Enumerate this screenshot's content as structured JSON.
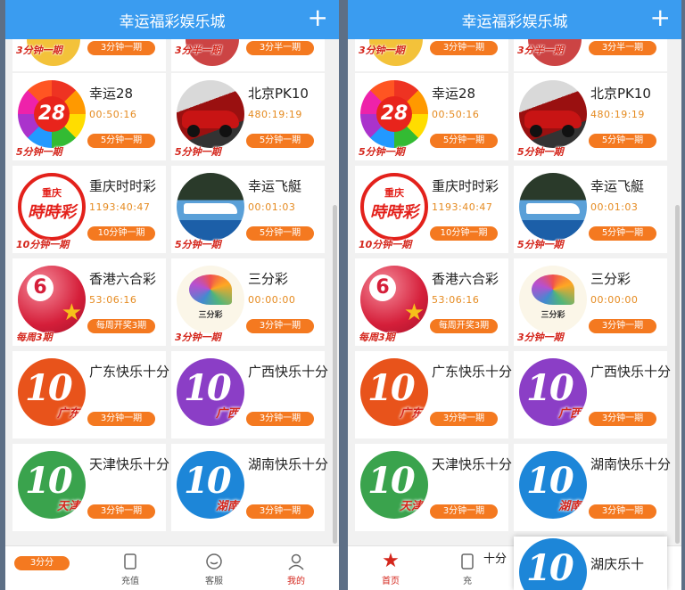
{
  "app_title": "幸运福彩娱乐城",
  "colors": {
    "header": "#3a9cf0",
    "pill": "#f47920",
    "timer": "#e58a1f",
    "badge": "#d4261c"
  },
  "top_partial": {
    "left_pill": "3分钟一期",
    "left_badge": "3分钟一期",
    "right_pill": "3分半一期",
    "right_badge": "3分半一期"
  },
  "games": [
    {
      "name": "幸运28",
      "timer": "00:50:16",
      "pill": "5分钟一期",
      "badge": "5分钟一期",
      "icon": "lucky28-wheel-icon",
      "icon_text": "28"
    },
    {
      "name": "北京PK10",
      "timer": "480:19:19",
      "pill": "5分钟一期",
      "badge": "5分钟一期",
      "icon": "race-car-icon"
    },
    {
      "name": "重庆时时彩",
      "timer": "1193:40:47",
      "pill": "10分钟一期",
      "badge": "10分钟一期",
      "icon": "chongqing-ssc-icon",
      "icon_top": "重庆",
      "icon_text": "時時彩"
    },
    {
      "name": "幸运飞艇",
      "timer": "00:01:03",
      "pill": "5分钟一期",
      "badge": "5分钟一期",
      "icon": "speedboat-icon"
    },
    {
      "name": "香港六合彩",
      "timer": "53:06:16",
      "pill": "每周开奖3期",
      "badge": "每周3期",
      "icon": "hk-mark-six-ball-icon",
      "icon_text": "6"
    },
    {
      "name": "三分彩",
      "timer": "00:00:00",
      "pill": "3分钟一期",
      "badge": "3分钟一期",
      "icon": "sanfencai-swirl-icon",
      "icon_text": "三分彩"
    },
    {
      "name": "广东快乐十分",
      "pill": "3分钟一期",
      "icon": "guangdong-10-icon",
      "icon_text": "10",
      "region": "广东",
      "color": "#e8531b"
    },
    {
      "name": "广西快乐十分",
      "pill": "3分钟一期",
      "icon": "guangxi-10-icon",
      "icon_text": "10",
      "region": "广西",
      "color": "#8b3ec6"
    },
    {
      "name": "天津快乐十分",
      "pill": "3分钟一期",
      "icon": "tianjin-10-icon",
      "icon_text": "10",
      "region": "天津",
      "color": "#3aa34d"
    },
    {
      "name": "湖南快乐十分",
      "pill": "3分钟一期",
      "icon": "hunan-10-icon",
      "icon_text": "10",
      "region": "湖南",
      "color": "#1d86d8"
    }
  ],
  "left_bottom": {
    "pill": "3分分",
    "tabs": [
      {
        "label": "充值",
        "icon": "doc-icon"
      },
      {
        "label": "客服",
        "icon": "chat-icon"
      },
      {
        "label": "我的",
        "icon": "user-icon"
      }
    ]
  },
  "right_bottom": {
    "tabs": [
      {
        "label": "首页",
        "icon": "star-icon"
      },
      {
        "label": "充",
        "icon": "doc-icon"
      }
    ],
    "drag_name": "湖庆乐十",
    "drag_fragment": "十分",
    "drag_icon_text": "10"
  }
}
